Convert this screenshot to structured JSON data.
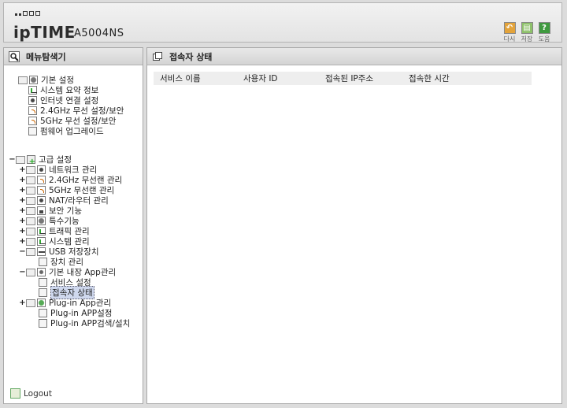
{
  "header": {
    "brand": "ipTIME",
    "model": "A5004NS",
    "buttons": [
      {
        "label": "다시",
        "icon": "undo-icon",
        "color": "#e3a33a"
      },
      {
        "label": "저장",
        "icon": "save-icon",
        "color": "#8dc06a"
      },
      {
        "label": "도움",
        "icon": "help-icon",
        "color": "#3f9a3f"
      }
    ]
  },
  "menu": {
    "title": "메뉴탐색기",
    "basic": {
      "label": "기본 설정",
      "items": [
        "시스템 요약 정보",
        "인터넷 연결 설정",
        "2.4GHz 무선 설정/보안",
        "5GHz 무선 설정/보안",
        "펌웨어 업그레이드"
      ]
    },
    "advanced": {
      "label": "고급 설정",
      "items": [
        "네트워크 관리",
        "2.4GHz 무선랜 관리",
        "5GHz 무선랜 관리",
        "NAT/라우터 관리",
        "보안 기능",
        "특수기능",
        "트래픽 관리",
        "시스템 관리",
        "USB 저장장치"
      ],
      "usb_children": [
        "장치 관리"
      ],
      "app_label": "기본 내장 App관리",
      "app_children": [
        "서비스 설정",
        "접속자 상태"
      ],
      "plugin_label": "Plug-in App관리",
      "plugin_children": [
        "Plug-in APP설정",
        "Plug-in APP검색/설치"
      ]
    },
    "logout": "Logout",
    "expand_plus": "+",
    "expand_minus": "−"
  },
  "content": {
    "title": "접속자 상태",
    "columns": [
      "서비스 이름",
      "사용자 ID",
      "접속된 IP주소",
      "접속한 시간"
    ]
  }
}
